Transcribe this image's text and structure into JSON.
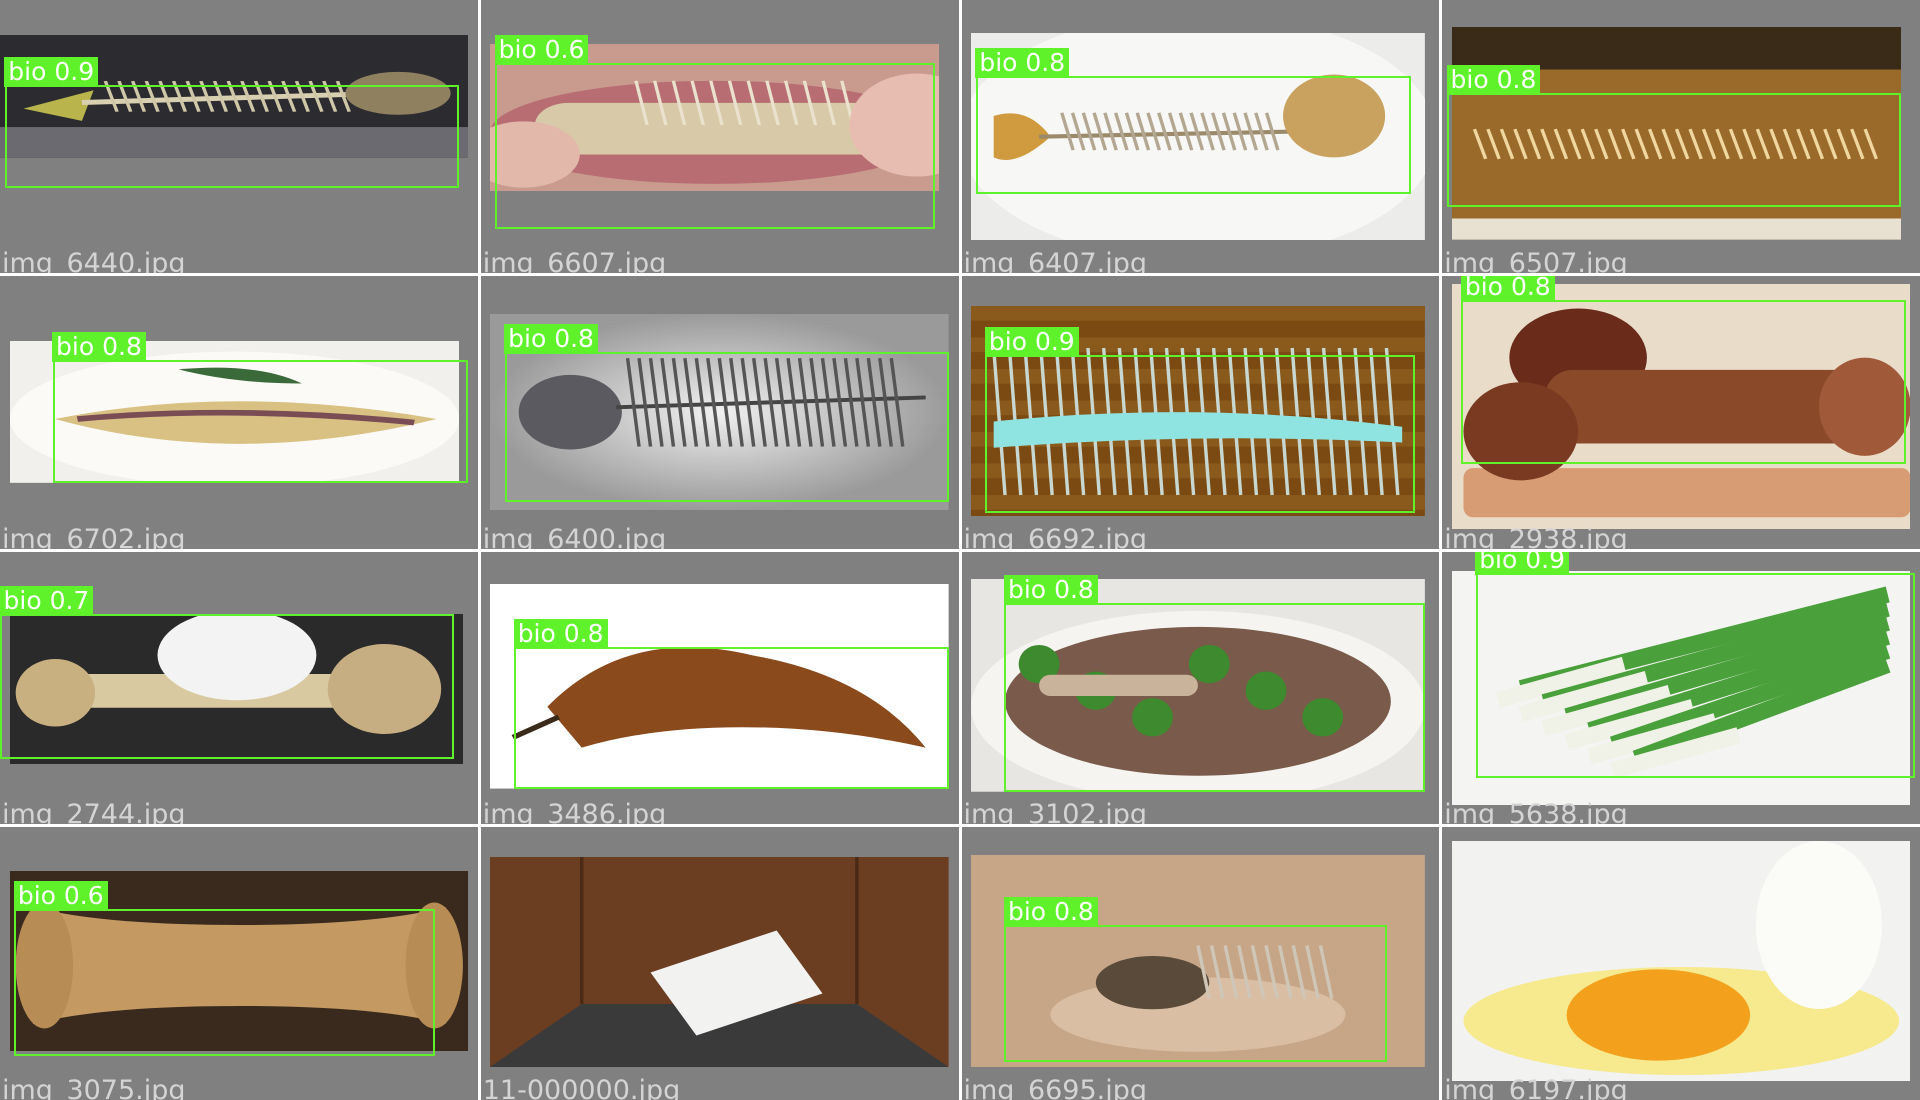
{
  "grid": {
    "tiles": [
      {
        "filename": "img_6440.jpg",
        "detection": {
          "class_name": "bio",
          "confidence": "0.9"
        },
        "subject": "fish-skeleton"
      },
      {
        "filename": "img_6607.jpg",
        "detection": {
          "class_name": "bio",
          "confidence": "0.6"
        },
        "subject": "fish-bones-in-hand"
      },
      {
        "filename": "img_6407.jpg",
        "detection": {
          "class_name": "bio",
          "confidence": "0.8"
        },
        "subject": "fish-skeleton-on-plate"
      },
      {
        "filename": "img_6507.jpg",
        "detection": {
          "class_name": "bio",
          "confidence": "0.8"
        },
        "subject": "fried-fish-bones"
      },
      {
        "filename": "img_6702.jpg",
        "detection": {
          "class_name": "bio",
          "confidence": "0.8"
        },
        "subject": "fish-on-plate"
      },
      {
        "filename": "img_6400.jpg",
        "detection": {
          "class_name": "bio",
          "confidence": "0.8"
        },
        "subject": "fish-skeleton-gray"
      },
      {
        "filename": "img_6692.jpg",
        "detection": {
          "class_name": "bio",
          "confidence": "0.9"
        },
        "subject": "fish-spine-on-wood"
      },
      {
        "filename": "img_2938.jpg",
        "detection": {
          "class_name": "bio",
          "confidence": "0.8"
        },
        "subject": "braised-bones-on-tray"
      },
      {
        "filename": "img_2744.jpg",
        "detection": {
          "class_name": "bio",
          "confidence": "0.7"
        },
        "subject": "bone-with-cat-paw"
      },
      {
        "filename": "img_3486.jpg",
        "detection": {
          "class_name": "bio",
          "confidence": "0.8"
        },
        "subject": "ripe-banana"
      },
      {
        "filename": "img_3102.jpg",
        "detection": {
          "class_name": "bio",
          "confidence": "0.8"
        },
        "subject": "bones-with-herbs-in-bowl"
      },
      {
        "filename": "img_5638.jpg",
        "detection": {
          "class_name": "bio",
          "confidence": "0.9"
        },
        "subject": "green-onions"
      },
      {
        "filename": "img_3075.jpg",
        "detection": {
          "class_name": "bio",
          "confidence": "0.6"
        },
        "subject": "large-bone"
      },
      {
        "filename": "11-000000.jpg",
        "detection": null,
        "subject": "white-box-in-elevator"
      },
      {
        "filename": "img_6695.jpg",
        "detection": {
          "class_name": "bio",
          "confidence": "0.8"
        },
        "subject": "fish-remains-on-table"
      },
      {
        "filename": "img_6197.jpg",
        "detection": null,
        "subject": "cracked-egg"
      }
    ]
  },
  "colors": {
    "detection_box": "#5ff22a",
    "tile_background": "#808080",
    "filename_text": "#d4d4d4",
    "label_text": "#ffffff"
  }
}
